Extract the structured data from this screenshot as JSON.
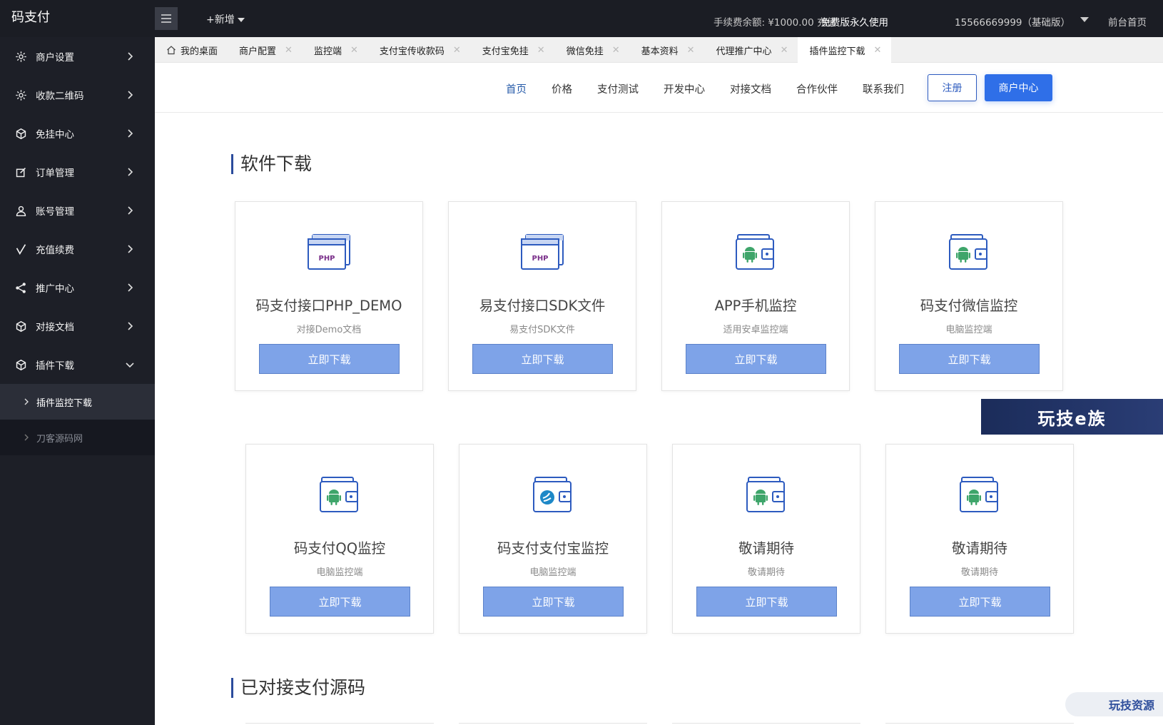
{
  "app": {
    "logo": "码支付"
  },
  "sidebar": {
    "items": [
      {
        "label": "商户设置",
        "icon": "gear-icon"
      },
      {
        "label": "收款二维码",
        "icon": "gear-icon"
      },
      {
        "label": "免挂中心",
        "icon": "cube-icon"
      },
      {
        "label": "订单管理",
        "icon": "edit-icon"
      },
      {
        "label": "账号管理",
        "icon": "user-icon"
      },
      {
        "label": "充值续费",
        "icon": "check-icon"
      },
      {
        "label": "推广中心",
        "icon": "share-icon"
      },
      {
        "label": "对接文档",
        "icon": "cube-icon"
      },
      {
        "label": "插件下载",
        "icon": "cube-icon"
      }
    ],
    "sub_items": [
      {
        "label": "插件监控下载"
      },
      {
        "label": "刀客源码网"
      }
    ]
  },
  "header": {
    "new_label": "+新增",
    "fee_balance": "手续费余额: ¥1000.00 充值",
    "free_use": "免费版永久使用",
    "user": "15566669999（基础版）",
    "home_link": "前台首页"
  },
  "tabs": [
    {
      "label": "我的桌面",
      "closable": false
    },
    {
      "label": "商户配置",
      "closable": true
    },
    {
      "label": "监控端",
      "closable": true
    },
    {
      "label": "支付宝传收款码",
      "closable": true
    },
    {
      "label": "支付宝免挂",
      "closable": true
    },
    {
      "label": "微信免挂",
      "closable": true
    },
    {
      "label": "基本资料",
      "closable": true
    },
    {
      "label": "代理推广中心",
      "closable": true
    },
    {
      "label": "插件监控下载",
      "closable": true,
      "active": true
    }
  ],
  "site_nav": {
    "links": [
      "首页",
      "价格",
      "支付测试",
      "开发中心",
      "对接文档",
      "合作伙伴",
      "联系我们"
    ],
    "register": "注册",
    "merchant_center": "商户中心"
  },
  "sections": {
    "software_download": "软件下载",
    "integrated_source": "已对接支付源码"
  },
  "cards": [
    {
      "title": "码支付接口PHP_DEMO",
      "subtitle": "对接Demo文档",
      "button": "立即下载",
      "icon": "php-window-icon"
    },
    {
      "title": "易支付接口SDK文件",
      "subtitle": "易支付SDK文件",
      "button": "立即下载",
      "icon": "php-window-icon"
    },
    {
      "title": "APP手机监控",
      "subtitle": "适用安卓监控端",
      "button": "立即下载",
      "icon": "android-wallet-icon"
    },
    {
      "title": "码支付微信监控",
      "subtitle": "电脑监控端",
      "button": "立即下载",
      "icon": "android-wallet-icon"
    },
    {
      "title": "码支付QQ监控",
      "subtitle": "电脑监控端",
      "button": "立即下载",
      "icon": "android-wallet-icon"
    },
    {
      "title": "码支付支付宝监控",
      "subtitle": "电脑监控端",
      "button": "立即下载",
      "icon": "alipay-wallet-icon"
    },
    {
      "title": "敬请期待",
      "subtitle": "敬请期待",
      "button": "立即下载",
      "icon": "android-wallet-icon"
    },
    {
      "title": "敬请期待",
      "subtitle": "敬请期待",
      "button": "立即下载",
      "icon": "android-wallet-icon"
    }
  ],
  "watermarks": {
    "banner": "玩技e族",
    "pill": "玩技资源"
  },
  "colors": {
    "sidebar_bg": "#1d1f27",
    "accent": "#2f6fe8",
    "button": "#7ea3e8"
  }
}
